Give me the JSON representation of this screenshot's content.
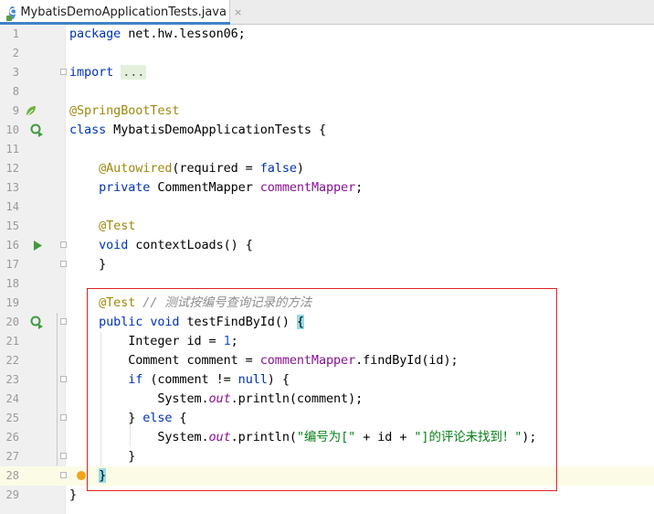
{
  "tab": {
    "icon_letter": "C",
    "filename": "MybatisDemoApplicationTests.java",
    "close_glyph": "×"
  },
  "gutter_icons": {
    "spring_leaf": "spring-leaf-icon",
    "run_test_class": "run-debug-icon",
    "run_test": "run-icon",
    "intention_bulb": "bulb-icon"
  },
  "colors": {
    "keyword": "#0033b3",
    "annotation": "#9e880d",
    "field": "#871094",
    "string": "#067d17",
    "comment": "#8c8c8c",
    "highlight_border": "#e02020"
  },
  "lines": {
    "l1": {
      "num": "1",
      "t1": "package",
      "t2": " net.hw.lesson06;"
    },
    "l2": {
      "num": "2"
    },
    "l3": {
      "num": "3",
      "t1": "import",
      "t2": " ",
      "t3": "..."
    },
    "l8": {
      "num": "8"
    },
    "l9": {
      "num": "9",
      "t1": "@SpringBootTest"
    },
    "l10": {
      "num": "10",
      "t1": "class",
      "t2": " MybatisDemoApplicationTests {"
    },
    "l11": {
      "num": "11"
    },
    "l12": {
      "num": "12",
      "t1": "    ",
      "t2": "@Autowired",
      "t3": "(required = ",
      "t4": "false",
      "t5": ")"
    },
    "l13": {
      "num": "13",
      "t1": "    ",
      "t2": "private",
      "t3": " CommentMapper ",
      "t4": "commentMapper",
      "t5": ";"
    },
    "l14": {
      "num": "14"
    },
    "l15": {
      "num": "15",
      "t1": "    ",
      "t2": "@Test"
    },
    "l16": {
      "num": "16",
      "t1": "    ",
      "t2": "void",
      "t3": " contextLoads() {"
    },
    "l17": {
      "num": "17",
      "t1": "    }"
    },
    "l18": {
      "num": "18"
    },
    "l19": {
      "num": "19",
      "t1": "    ",
      "t2": "@Test",
      "t3": " ",
      "t4": "// 测试按编号查询记录的方法"
    },
    "l20": {
      "num": "20",
      "t1": "    ",
      "t2": "public",
      "t3": " ",
      "t4": "void",
      "t5": " testFindById() ",
      "t6": "{"
    },
    "l21": {
      "num": "21",
      "t1": "        Integer id = ",
      "t2": "1",
      "t3": ";"
    },
    "l22": {
      "num": "22",
      "t1": "        Comment comment = ",
      "t2": "commentMapper",
      "t3": ".findById(id);"
    },
    "l23": {
      "num": "23",
      "t1": "        ",
      "t2": "if",
      "t3": " (comment != ",
      "t4": "null",
      "t5": ") {"
    },
    "l24": {
      "num": "24",
      "t1": "            System.",
      "t2": "out",
      "t3": ".println(comment);"
    },
    "l25": {
      "num": "25",
      "t1": "        } ",
      "t2": "else",
      "t3": " {"
    },
    "l26": {
      "num": "26",
      "t1": "            System.",
      "t2": "out",
      "t3": ".println(",
      "t4": "\"编号为[\"",
      "t5": " + id + ",
      "t6": "\"]的评论未找到！\"",
      "t7": ");"
    },
    "l27": {
      "num": "27",
      "t1": "        }"
    },
    "l28": {
      "num": "28",
      "t1": "    ",
      "t2": "}"
    },
    "l29": {
      "num": "29",
      "t1": "}"
    }
  }
}
